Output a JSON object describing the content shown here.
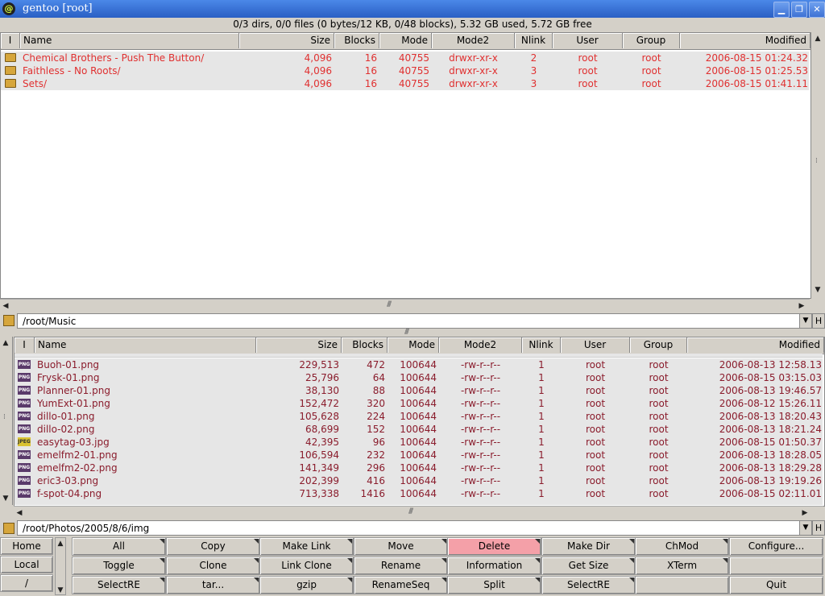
{
  "window": {
    "title": "gentoo [root]",
    "status": "0/3 dirs, 0/0 files (0 bytes/12 KB, 0/48 blocks), 5.32 GB used, 5.72 GB free"
  },
  "colors": {
    "dir_text": "#e03030",
    "file_text": "#8a1c2c",
    "delete_bg": "#f4a0a8",
    "title_bg": "#2f6bd3"
  },
  "columns": [
    "I",
    "Name",
    "Size",
    "Blocks",
    "Mode",
    "Mode2",
    "Nlink",
    "User",
    "Group",
    "Modified"
  ],
  "top_panel": {
    "path": "/root/Music",
    "rows": [
      {
        "name": "Chemical Brothers - Push The Button/",
        "size": "4,096",
        "blocks": "16",
        "mode": "40755",
        "mode2": "drwxr-xr-x",
        "nlink": "2",
        "user": "root",
        "group": "root",
        "modified": "2006-08-15 01:24.32"
      },
      {
        "name": "Faithless - No Roots/",
        "size": "4,096",
        "blocks": "16",
        "mode": "40755",
        "mode2": "drwxr-xr-x",
        "nlink": "3",
        "user": "root",
        "group": "root",
        "modified": "2006-08-15 01:25.53"
      },
      {
        "name": "Sets/",
        "size": "4,096",
        "blocks": "16",
        "mode": "40755",
        "mode2": "drwxr-xr-x",
        "nlink": "3",
        "user": "root",
        "group": "root",
        "modified": "2006-08-15 01:41.11"
      }
    ]
  },
  "bottom_panel": {
    "path": "/root/Photos/2005/8/6/img",
    "rows": [
      {
        "icon": "PNG",
        "name": "Buoh-01.png",
        "size": "229,513",
        "blocks": "472",
        "mode": "100644",
        "mode2": "-rw-r--r--",
        "nlink": "1",
        "user": "root",
        "group": "root",
        "modified": "2006-08-13 12:58.13"
      },
      {
        "icon": "PNG",
        "name": "Frysk-01.png",
        "size": "25,796",
        "blocks": "64",
        "mode": "100644",
        "mode2": "-rw-r--r--",
        "nlink": "1",
        "user": "root",
        "group": "root",
        "modified": "2006-08-15 03:15.03"
      },
      {
        "icon": "PNG",
        "name": "Planner-01.png",
        "size": "38,130",
        "blocks": "88",
        "mode": "100644",
        "mode2": "-rw-r--r--",
        "nlink": "1",
        "user": "root",
        "group": "root",
        "modified": "2006-08-13 19:46.57"
      },
      {
        "icon": "PNG",
        "name": "YumExt-01.png",
        "size": "152,472",
        "blocks": "320",
        "mode": "100644",
        "mode2": "-rw-r--r--",
        "nlink": "1",
        "user": "root",
        "group": "root",
        "modified": "2006-08-12 15:26.11"
      },
      {
        "icon": "PNG",
        "name": "dillo-01.png",
        "size": "105,628",
        "blocks": "224",
        "mode": "100644",
        "mode2": "-rw-r--r--",
        "nlink": "1",
        "user": "root",
        "group": "root",
        "modified": "2006-08-13 18:20.43"
      },
      {
        "icon": "PNG",
        "name": "dillo-02.png",
        "size": "68,699",
        "blocks": "152",
        "mode": "100644",
        "mode2": "-rw-r--r--",
        "nlink": "1",
        "user": "root",
        "group": "root",
        "modified": "2006-08-13 18:21.24"
      },
      {
        "icon": "JPEG",
        "name": "easytag-03.jpg",
        "size": "42,395",
        "blocks": "96",
        "mode": "100644",
        "mode2": "-rw-r--r--",
        "nlink": "1",
        "user": "root",
        "group": "root",
        "modified": "2006-08-15 01:50.37"
      },
      {
        "icon": "PNG",
        "name": "emelfm2-01.png",
        "size": "106,594",
        "blocks": "232",
        "mode": "100644",
        "mode2": "-rw-r--r--",
        "nlink": "1",
        "user": "root",
        "group": "root",
        "modified": "2006-08-13 18:28.05"
      },
      {
        "icon": "PNG",
        "name": "emelfm2-02.png",
        "size": "141,349",
        "blocks": "296",
        "mode": "100644",
        "mode2": "-rw-r--r--",
        "nlink": "1",
        "user": "root",
        "group": "root",
        "modified": "2006-08-13 18:29.28"
      },
      {
        "icon": "PNG",
        "name": "eric3-03.png",
        "size": "202,399",
        "blocks": "416",
        "mode": "100644",
        "mode2": "-rw-r--r--",
        "nlink": "1",
        "user": "root",
        "group": "root",
        "modified": "2006-08-13 19:19.26"
      },
      {
        "icon": "PNG",
        "name": "f-spot-04.png",
        "size": "713,338",
        "blocks": "1416",
        "mode": "100644",
        "mode2": "-rw-r--r--",
        "nlink": "1",
        "user": "root",
        "group": "root",
        "modified": "2006-08-15 02:11.01"
      }
    ]
  },
  "side_buttons": [
    "Home",
    "Local",
    "/"
  ],
  "path_h_label": "H",
  "buttons": [
    [
      "All",
      "Copy",
      "Make Link",
      "Move",
      "Delete",
      "Make Dir",
      "ChMod",
      "Configure..."
    ],
    [
      "Toggle",
      "Clone",
      "Link Clone",
      "Rename",
      "Information",
      "Get Size",
      "XTerm",
      ""
    ],
    [
      "SelectRE",
      "tar...",
      "gzip",
      "RenameSeq",
      "Split",
      "SelectRE",
      "",
      "Quit"
    ]
  ]
}
